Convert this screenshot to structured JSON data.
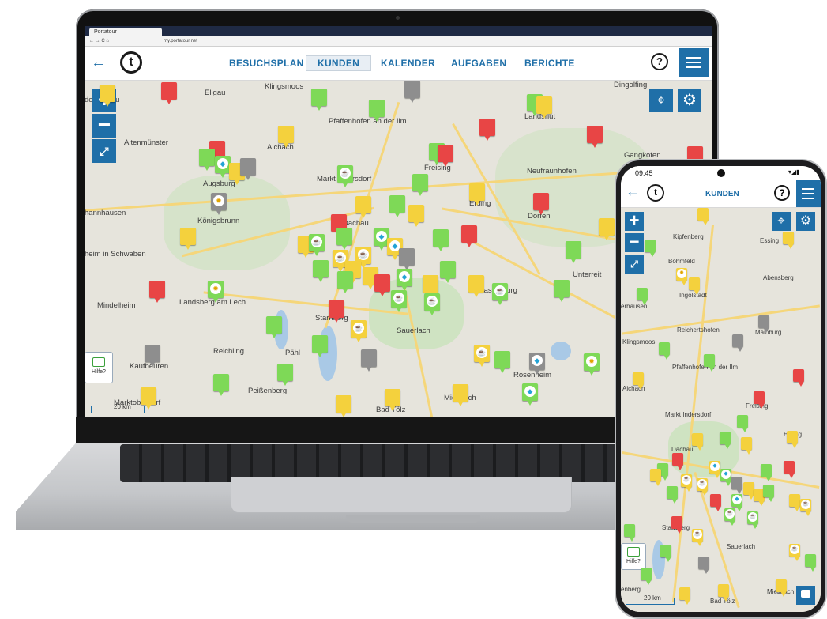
{
  "browser": {
    "tab_title": "Portatour",
    "url": "my.portatour.net"
  },
  "app": {
    "back_glyph": "←",
    "logo_letter": "t",
    "nav": [
      {
        "label": "BESUCHSPLAN"
      },
      {
        "label": "KUNDEN"
      },
      {
        "label": "KALENDER"
      },
      {
        "label": "AUFGABEN"
      },
      {
        "label": "BERICHTE"
      }
    ],
    "active_nav": "KUNDEN",
    "help_glyph": "?",
    "hilfe_label": "Hilfe?",
    "scale_label": "20 km"
  },
  "map_labels": {
    "laptop": [
      "Ellgau",
      "Klingsmoos",
      "der Donau",
      "Pfaffenhofen an der Ilm",
      "Landshut",
      "Altenmünster",
      "Aichach",
      "Gangkofen",
      "Freising",
      "Neufraunhofen",
      "Augsburg",
      "Markt Indersdorf",
      "Erding",
      "Dorfen",
      "hannhausen",
      "Königsbrunn",
      "Dachau",
      "heim in Schwaben",
      "Unterreit",
      "Landsberg am Lech",
      "Mindelheim",
      "Starnberg",
      "Sauerlach",
      "Reichling",
      "Pähl",
      "Kaufbeuren",
      "Rosenheim",
      "Peißenberg",
      "Bad Tölz",
      "Miesbach",
      "Marktoberdorf",
      "Wasserburg",
      "Dingolfing"
    ],
    "phone": [
      "Kipfenberg",
      "Essing",
      "Böhmfeld",
      "Abensberg",
      "Ingolstadt",
      "Reichertshofen",
      "Mainburg",
      "Klingsmoos",
      "Pfaffenhofen an der Ilm",
      "Aichach",
      "Freising",
      "Markt Indersdorf",
      "Erding",
      "Dachau",
      "Starnberg",
      "Sauerlach",
      "Bad Tölz",
      "Miesbach",
      "erhausen",
      "enberg"
    ]
  },
  "phone": {
    "time": "09:45",
    "title": "KUNDEN",
    "status_icons": "▾◢▮"
  },
  "icons": {
    "zoom_in": "plus-icon",
    "zoom_out": "minus-icon",
    "fullscreen": "expand-icon",
    "locate": "crosshair-icon",
    "settings": "gear-icon",
    "menu": "hamburger-icon",
    "chat": "chat-bubble-icon"
  },
  "colors": {
    "brand": "#1f6fa8",
    "pin_green": "#7ed957",
    "pin_yellow": "#f4d13d",
    "pin_red": "#e84545",
    "pin_gray": "#8e8e8e"
  }
}
